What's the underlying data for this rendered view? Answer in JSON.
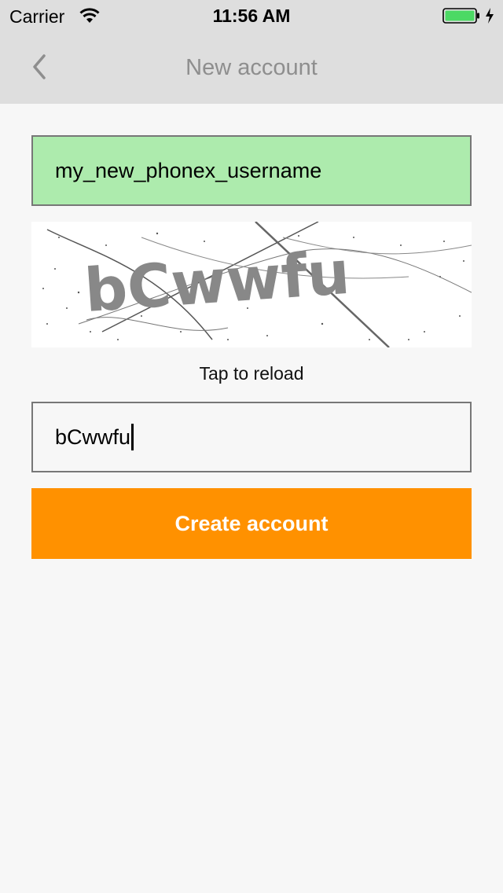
{
  "status_bar": {
    "carrier": "Carrier",
    "time": "11:56 AM",
    "battery_color": "#4cd964"
  },
  "nav": {
    "title": "New account",
    "back_icon": "chevron-left-icon"
  },
  "form": {
    "username_value": "my_new_phonex_username",
    "username_bg": "#adebad",
    "captcha_text": "bCwwfu",
    "reload_label": "Tap to reload",
    "captcha_input_value": "bCwwfu",
    "create_label": "Create account",
    "create_color": "#ff9100"
  }
}
